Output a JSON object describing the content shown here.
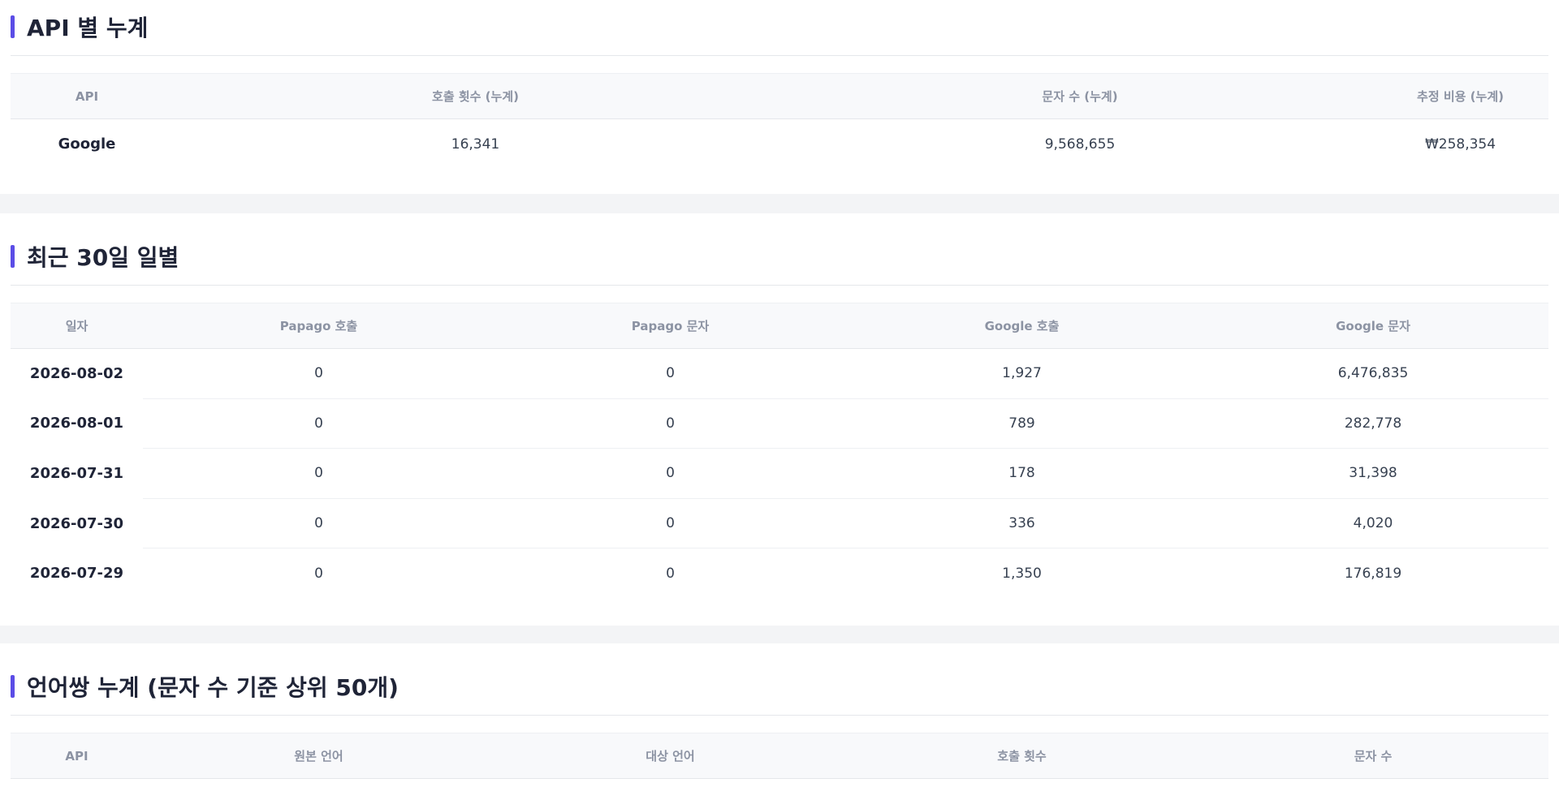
{
  "api_section": {
    "title": "API 별 누계",
    "headers": [
      "API",
      "호출 횟수 (누계)",
      "문자 수 (누계)",
      "추정 비용 (누계)"
    ],
    "rows": [
      [
        "Google",
        "16,341",
        "9,568,655",
        "₩258,354"
      ]
    ]
  },
  "daily_section": {
    "title": "최근 30일 일별",
    "headers": [
      "일자",
      "Papago 호출",
      "Papago 문자",
      "Google 호출",
      "Google 문자"
    ],
    "rows": [
      [
        "2026-08-02",
        "0",
        "0",
        "1,927",
        "6,476,835"
      ],
      [
        "2026-08-01",
        "0",
        "0",
        "789",
        "282,778"
      ],
      [
        "2026-07-31",
        "0",
        "0",
        "178",
        "31,398"
      ],
      [
        "2026-07-30",
        "0",
        "0",
        "336",
        "4,020"
      ],
      [
        "2026-07-29",
        "0",
        "0",
        "1,350",
        "176,819"
      ]
    ]
  },
  "lang_section": {
    "title": "언어쌍 누계 (문자 수 기준 상위 50개)",
    "headers": [
      "API",
      "원본 언어",
      "대상 언어",
      "호출 횟수",
      "문자 수"
    ]
  },
  "colors": {
    "accent": "#5b4de6",
    "header_bg": "#f8f9fb",
    "header_text": "#8c93a3"
  }
}
